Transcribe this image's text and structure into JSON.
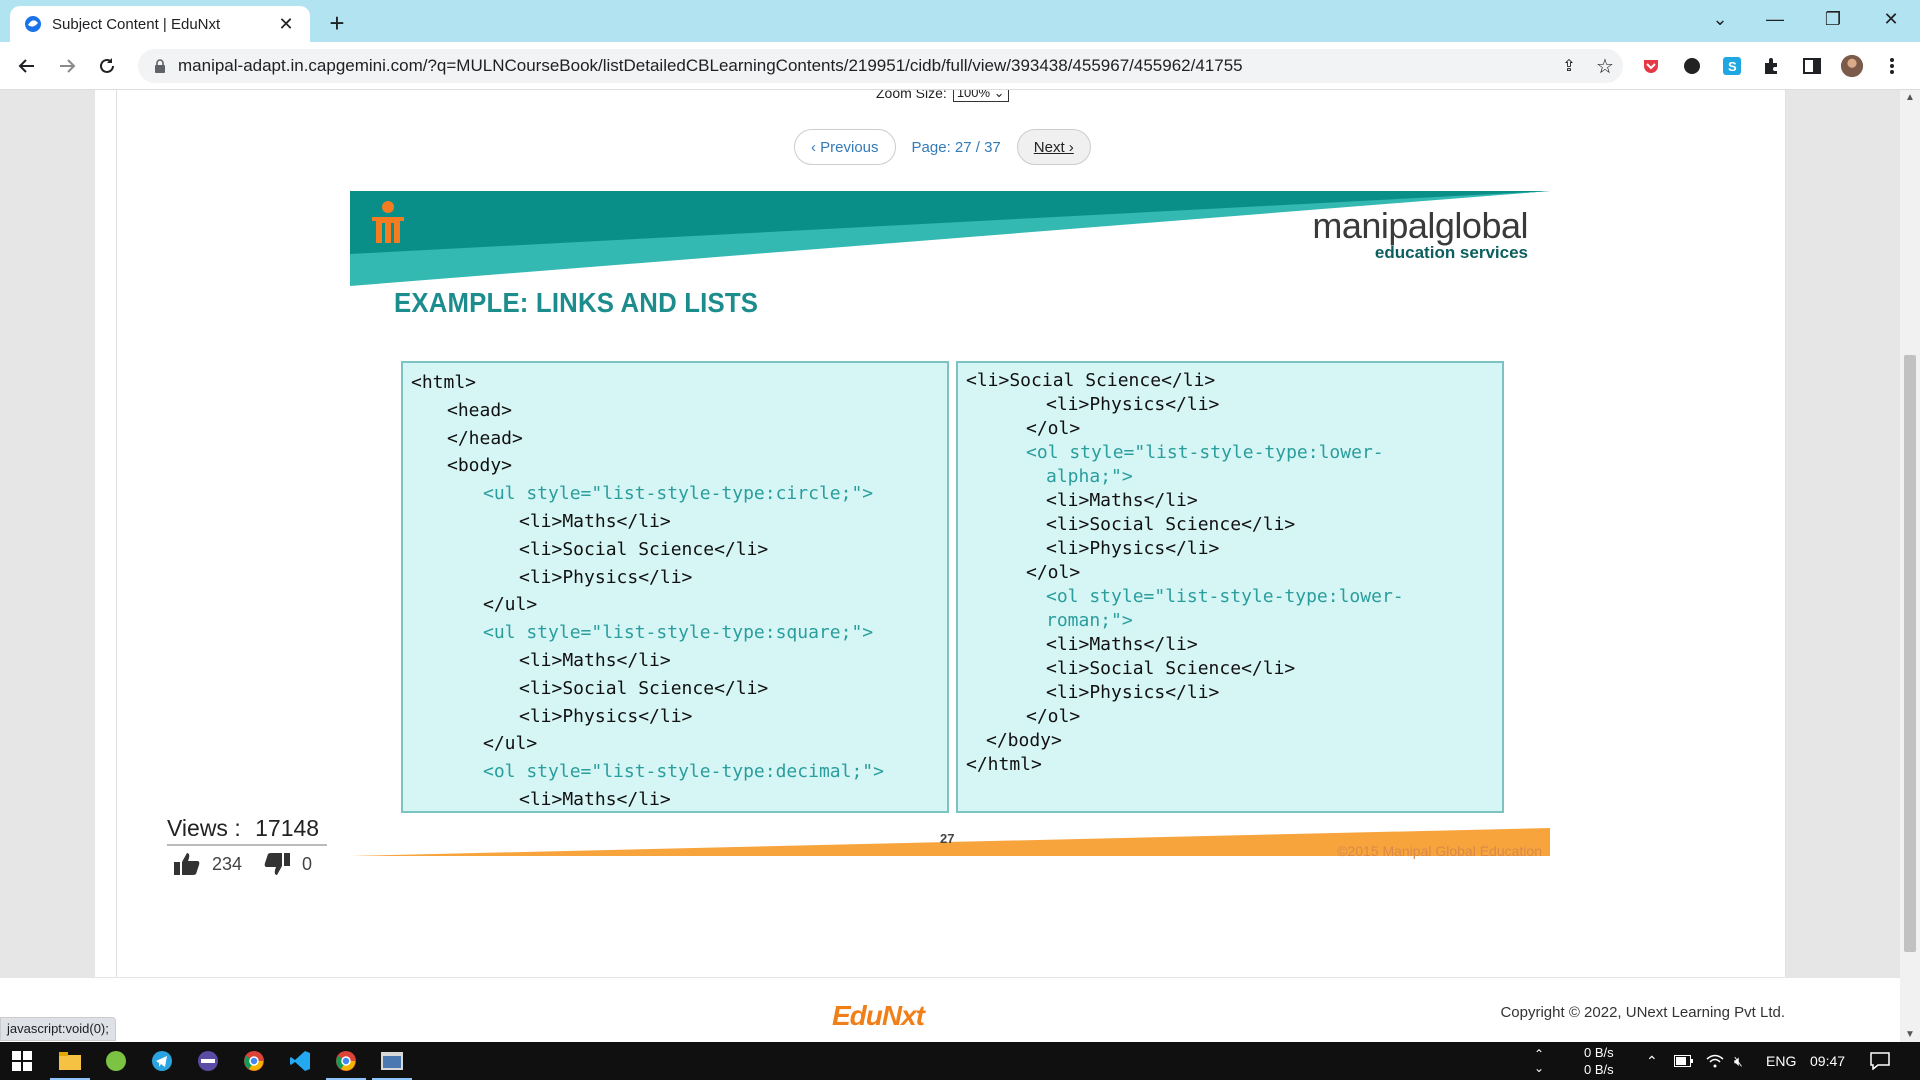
{
  "browser": {
    "tab_title": "Subject Content | EduNxt",
    "new_tab": "+",
    "url": "manipal-adapt.in.capgemini.com/?q=MULNCourseBook/listDetailedCBLearningContents/219951/cidb/full/view/393438/455967/455962/41755"
  },
  "viewer": {
    "zoom_label": "Zoom Size:",
    "zoom_value": "100%",
    "prev_label": "‹ Previous",
    "page_label": "Page: 27 / 37",
    "next_label": "Next ›"
  },
  "slide": {
    "brand_main": "manipalglobal",
    "brand_sub": "education services",
    "title": "EXAMPLE: LINKS AND LISTS",
    "left_code": [
      {
        "text": "<html>",
        "indent": 0,
        "attr": false
      },
      {
        "text": "<head>",
        "indent": 1,
        "attr": false
      },
      {
        "text": "</head>",
        "indent": 1,
        "attr": false
      },
      {
        "text": "<body>",
        "indent": 1,
        "attr": false
      },
      {
        "text": "<ul style=\"list-style-type:circle;\">",
        "indent": 2,
        "attr": true
      },
      {
        "text": "<li>Maths</li>",
        "indent": 3,
        "attr": false
      },
      {
        "text": "<li>Social Science</li>",
        "indent": 3,
        "attr": false
      },
      {
        "text": "<li>Physics</li>",
        "indent": 3,
        "attr": false
      },
      {
        "text": "</ul>",
        "indent": 2,
        "attr": false
      },
      {
        "text": "<ul style=\"list-style-type:square;\">",
        "indent": 2,
        "attr": true
      },
      {
        "text": "<li>Maths</li>",
        "indent": 3,
        "attr": false
      },
      {
        "text": "<li>Social Science</li>",
        "indent": 3,
        "attr": false
      },
      {
        "text": "<li>Physics</li>",
        "indent": 3,
        "attr": false
      },
      {
        "text": "</ul>",
        "indent": 2,
        "attr": false
      },
      {
        "text": "<ol style=\"list-style-type:decimal;\">",
        "indent": 2,
        "attr": true
      },
      {
        "text": "<li>Maths</li>",
        "indent": 3,
        "attr": false
      }
    ],
    "right_code": [
      {
        "text": "<li>Social Science</li>",
        "indent": 0,
        "attr": false
      },
      {
        "text": "<li>Physics</li>",
        "indent": 4,
        "attr": false
      },
      {
        "text": "</ol>",
        "indent": 3,
        "attr": false
      },
      {
        "text": "<ol style=\"list-style-type:lower-",
        "indent": 3,
        "attr": true
      },
      {
        "text": "alpha;\">",
        "indent": 4,
        "attr": true
      },
      {
        "text": "<li>Maths</li>",
        "indent": 4,
        "attr": false
      },
      {
        "text": "<li>Social Science</li>",
        "indent": 4,
        "attr": false
      },
      {
        "text": "<li>Physics</li>",
        "indent": 4,
        "attr": false
      },
      {
        "text": "</ol>",
        "indent": 3,
        "attr": false
      },
      {
        "text": "<ol style=\"list-style-type:lower-",
        "indent": 4,
        "attr": true
      },
      {
        "text": "roman;\">",
        "indent": 4,
        "attr": true
      },
      {
        "text": "<li>Maths</li>",
        "indent": 4,
        "attr": false
      },
      {
        "text": "<li>Social Science</li>",
        "indent": 4,
        "attr": false
      },
      {
        "text": "<li>Physics</li>",
        "indent": 4,
        "attr": false
      },
      {
        "text": "</ol>",
        "indent": 3,
        "attr": false
      },
      {
        "text": "</body>",
        "indent": 1,
        "attr": false
      },
      {
        "text": "</html>",
        "indent": 0,
        "attr": false
      }
    ],
    "page_number": "27",
    "copyright": "©2015 Manipal Global Education"
  },
  "stats": {
    "views_label": "Views :",
    "views_value": "17148",
    "likes": "234",
    "dislikes": "0"
  },
  "footer": {
    "logo": "EduNxt",
    "copyright": "Copyright © 2022, UNext Learning Pvt Ltd.",
    "status_text": "javascript:void(0);"
  },
  "taskbar": {
    "net_up": "0 B/s",
    "net_down": "0 B/s",
    "lang": "ENG",
    "time": "09:47"
  },
  "colors": {
    "teal_dark": "#0a8f88",
    "teal_light": "#33b8b2",
    "code_bg": "#d6f5f5",
    "code_attr": "#2a9d9d",
    "orange": "#f7a43c",
    "tabstrip": "#b1e4f0"
  }
}
